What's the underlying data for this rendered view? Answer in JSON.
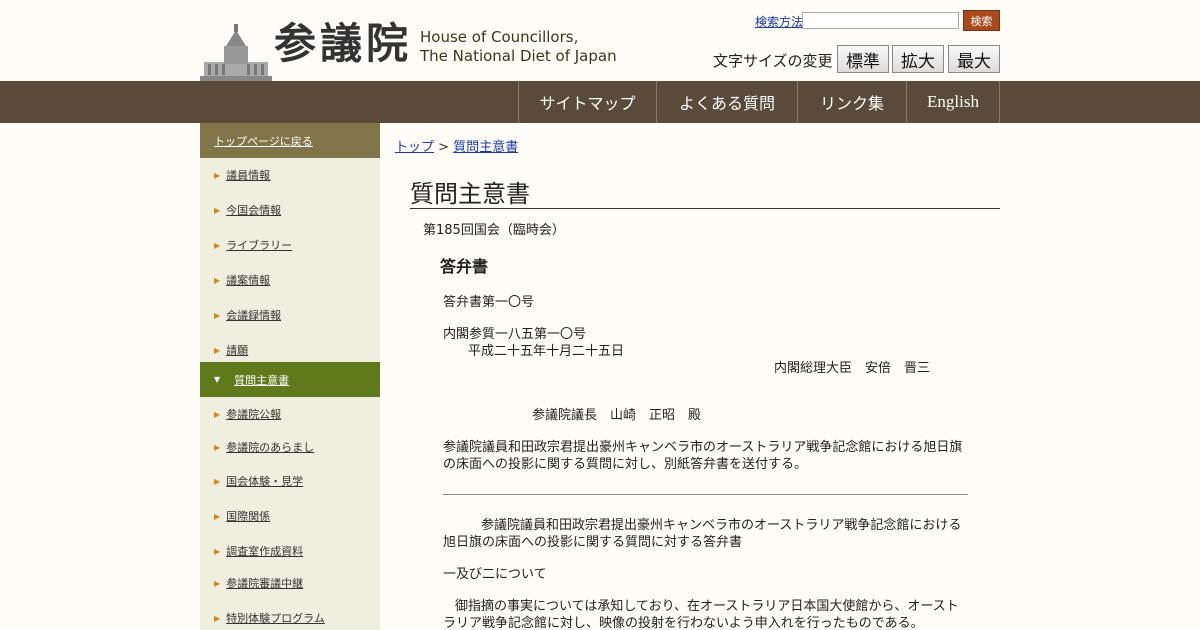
{
  "header": {
    "logo_kanji": "参議院",
    "logo_en_line1": "House of Councillors,",
    "logo_en_line2": "The National Diet of Japan",
    "search_link": "検索方法",
    "search_value": "",
    "search_button": "検索",
    "fontsize_label": "文字サイズの変更",
    "fontsize_buttons": [
      "標準",
      "拡大",
      "最大"
    ]
  },
  "nav": {
    "items": [
      "サイトマップ",
      "よくある質問",
      "リンク集",
      "English"
    ]
  },
  "sidebar": {
    "top_link": "トップページに戻る",
    "items": [
      "議員情報",
      "今国会情報",
      "ライブラリー",
      "議案情報",
      "会議録情報",
      "請願"
    ],
    "active": "質問主意書",
    "items_after": [
      "参議院公報",
      "参議院のあらまし",
      "国会体験・見学",
      "国際関係",
      "調査室作成資料",
      "参議院審議中継",
      "特別体験プログラム"
    ]
  },
  "breadcrumb": {
    "home": "トップ",
    "separator": ">",
    "current": "質問主意書"
  },
  "main": {
    "title": "質問主意書",
    "session": "第185回国会（臨時会）",
    "answer_heading": "答弁書",
    "answer_no": "答弁書第一〇号",
    "ref_no": "内閣参質一八五第一〇号",
    "date": "平成二十五年十月二十五日",
    "sender": "内閣総理大臣　安倍　晋三",
    "recipient": "参議院議長　山崎　正昭　殿",
    "para1_line1": "参議院議員和田政宗君提出豪州キャンベラ市のオーストラリア戦争記念館における旭日旗",
    "para1_line2": "の床面への投影に関する質問に対し、別紙答弁書を送付する。",
    "para2_line1": "参議院議員和田政宗君提出豪州キャンベラ市のオーストラリア戦争記念館における",
    "para2_line2": "旭日旗の床面への投影に関する質問に対する答弁書",
    "section": "一及び二について",
    "para3_line1": "御指摘の事実については承知しており、在オーストラリア日本国大使館から、オースト",
    "para3_line2": "ラリア戦争記念館に対し、映像の投射を行わないよう申入れを行ったものである。"
  }
}
